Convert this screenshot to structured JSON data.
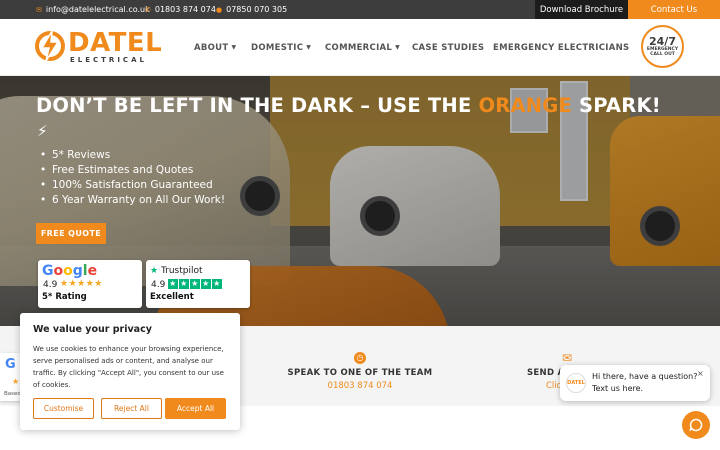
{
  "topbar": {
    "email": "info@datelelectrical.co.uk",
    "phone1": "01803 874 074",
    "phone2": "07850 070 305",
    "brochure_label": "Download Brochure",
    "contact_label": "Contact Us"
  },
  "header": {
    "logo_word": "DATEL",
    "logo_sub": "ELECTRICAL",
    "nav": [
      {
        "label": "ABOUT",
        "has_dropdown": true
      },
      {
        "label": "DOMESTIC",
        "has_dropdown": true
      },
      {
        "label": "COMMERCIAL",
        "has_dropdown": true
      },
      {
        "label": "CASE STUDIES",
        "has_dropdown": false
      },
      {
        "label": "EMERGENCY ELECTRICIANS",
        "has_dropdown": false
      }
    ],
    "badge_big": "24/7",
    "badge_small": "EMERGENCY CALL OUT"
  },
  "hero": {
    "headline_part1": "DON’T BE LEFT IN THE DARK – USE THE ",
    "headline_orange": "ORANGE",
    "headline_part2": " SPARK!",
    "bolt": "⚡",
    "bullets": [
      "5* Reviews",
      "Free Estimates and Quotes",
      "100% Satisfaction Guaranteed",
      "6 Year Warranty on All Our Work!"
    ],
    "quote_button": "FREE QUOTE",
    "reviews": [
      {
        "brand": "Google",
        "score": "4.9",
        "label": "5* Rating"
      },
      {
        "brand": "Trustpilot",
        "score": "4.9",
        "label": "Excellent"
      }
    ]
  },
  "band": {
    "speak_title": "SPEAK TO ONE OF THE TEAM",
    "speak_value": "01803 874 074",
    "send_title": "SEND A",
    "send_value": "Clic"
  },
  "cookie": {
    "title": "We value your privacy",
    "text": "We use cookies to enhance your browsing experience, serve personalised ads or content, and analyse our traffic. By clicking \"Accept All\", you consent to our use of cookies.",
    "customise": "Customise",
    "reject": "Reject All",
    "accept": "Accept All"
  },
  "google_badge": {
    "letter": "G",
    "text": "Based"
  },
  "chat": {
    "avatar_text": "DATEL",
    "line1": "Hi there, have a question?",
    "line2": "Text us here.",
    "close": "×"
  },
  "colors": {
    "accent": "#f08a1c",
    "dark": "#3d3d3d",
    "trustpilot": "#00b67a"
  },
  "icons": [
    "email-icon",
    "phone-icon",
    "mobile-icon",
    "clock-icon",
    "envelope-icon",
    "chat-icon",
    "close-icon",
    "star-icon"
  ]
}
